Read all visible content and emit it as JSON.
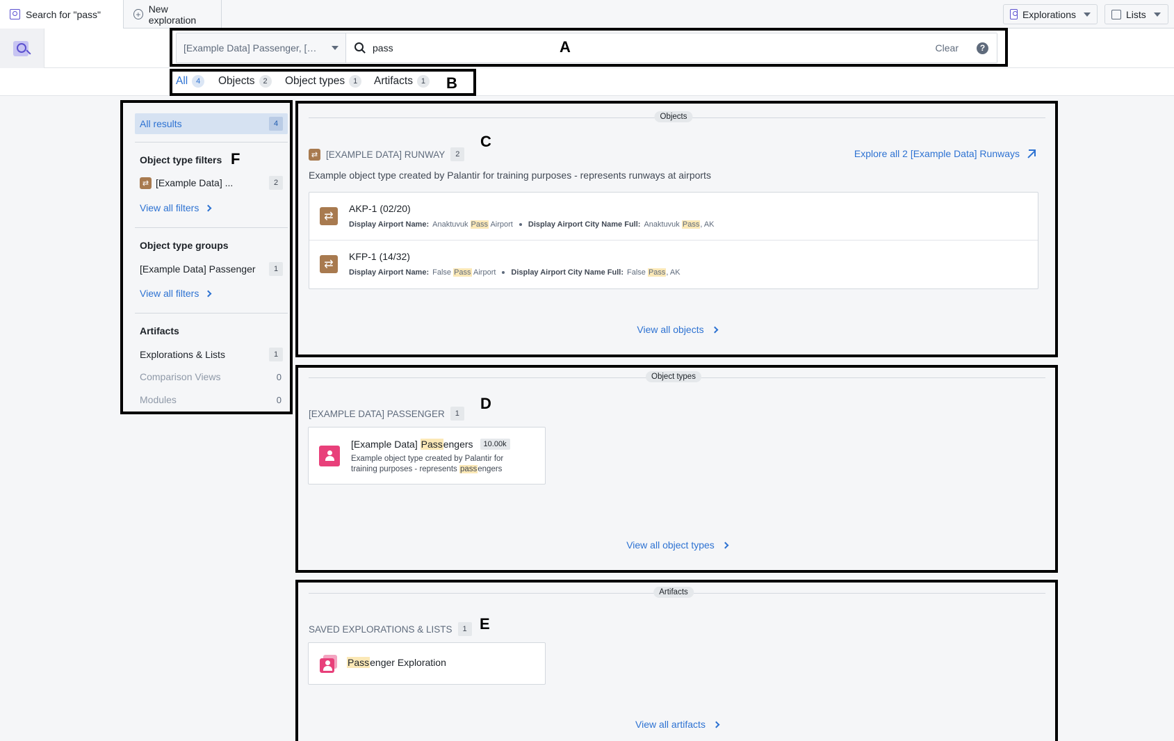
{
  "window": {
    "active_tab": "Search for \"pass\"",
    "new_tab": "New exploration",
    "explorations_button": "Explorations",
    "lists_button": "Lists"
  },
  "search": {
    "scope": "[Example Data] Passenger, [Example Data] Runway",
    "query": "pass",
    "clear_label": "Clear",
    "help_icon": "?"
  },
  "result_tabs": [
    {
      "label": "All",
      "count": "4"
    },
    {
      "label": "Objects",
      "count": "2"
    },
    {
      "label": "Object types",
      "count": "1"
    },
    {
      "label": "Artifacts",
      "count": "1"
    }
  ],
  "annotations": {
    "a": "A",
    "b": "B",
    "c": "C",
    "d": "D",
    "e": "E",
    "f": "F"
  },
  "sidebar": {
    "all_results": {
      "label": "All results",
      "count": "4"
    },
    "object_type_filters": {
      "heading": "Object type filters",
      "items": [
        {
          "label": "[Example Data] ...",
          "count": "2",
          "icon": "runway-icon"
        }
      ],
      "view_all": "View all filters"
    },
    "object_type_groups": {
      "heading": "Object type groups",
      "items": [
        {
          "label": "[Example Data] Passenger",
          "count": "1"
        }
      ],
      "view_all": "View all filters"
    },
    "artifacts": {
      "heading": "Artifacts",
      "items": [
        {
          "label": "Explorations & Lists",
          "count": "1"
        },
        {
          "label": "Comparison Views",
          "count": "0"
        },
        {
          "label": "Modules",
          "count": "0"
        }
      ]
    }
  },
  "objects_section": {
    "chip": "Objects",
    "group_title": "[EXAMPLE DATA] RUNWAY",
    "group_count": "2",
    "explore_link": "Explore all 2 [Example Data] Runways",
    "description": "Example object type created by Palantir for training purposes - represents runways at airports",
    "items": [
      {
        "title": "AKP-1 (02/20)",
        "prop1_label": "Display Airport Name:",
        "prop1_pre": "Anaktuvuk ",
        "prop1_hl": "Pass",
        "prop1_post": " Airport",
        "prop2_label": "Display Airport City Name Full:",
        "prop2_pre": "Anaktuvuk ",
        "prop2_hl": "Pass",
        "prop2_post": ", AK"
      },
      {
        "title": "KFP-1 (14/32)",
        "prop1_label": "Display Airport Name:",
        "prop1_pre": "False ",
        "prop1_hl": "Pass",
        "prop1_post": " Airport",
        "prop2_label": "Display Airport City Name Full:",
        "prop2_pre": "False ",
        "prop2_hl": "Pass",
        "prop2_post": ", AK"
      }
    ],
    "view_all": "View all objects"
  },
  "object_types_section": {
    "chip": "Object types",
    "group_title": "[EXAMPLE DATA] PASSENGER",
    "group_count": "1",
    "card": {
      "title_pre": "[Example Data] ",
      "title_hl": "Pass",
      "title_post": "engers",
      "badge": "10.00k",
      "desc_pre": "Example object type created by Palantir for training purposes - represents ",
      "desc_hl": "pass",
      "desc_post": "engers"
    },
    "view_all": "View all object types"
  },
  "artifacts_section": {
    "chip": "Artifacts",
    "group_title": "SAVED EXPLORATIONS & LISTS",
    "group_count": "1",
    "card": {
      "title_hl": "Pass",
      "title_post": "enger Exploration"
    },
    "view_all": "View all artifacts"
  },
  "colors": {
    "accent": "#2d72d2",
    "runway_icon": "#a87a4f",
    "passenger_icon": "#e8407a",
    "highlight": "#fbe8b6",
    "annotation_border": "#000000"
  }
}
